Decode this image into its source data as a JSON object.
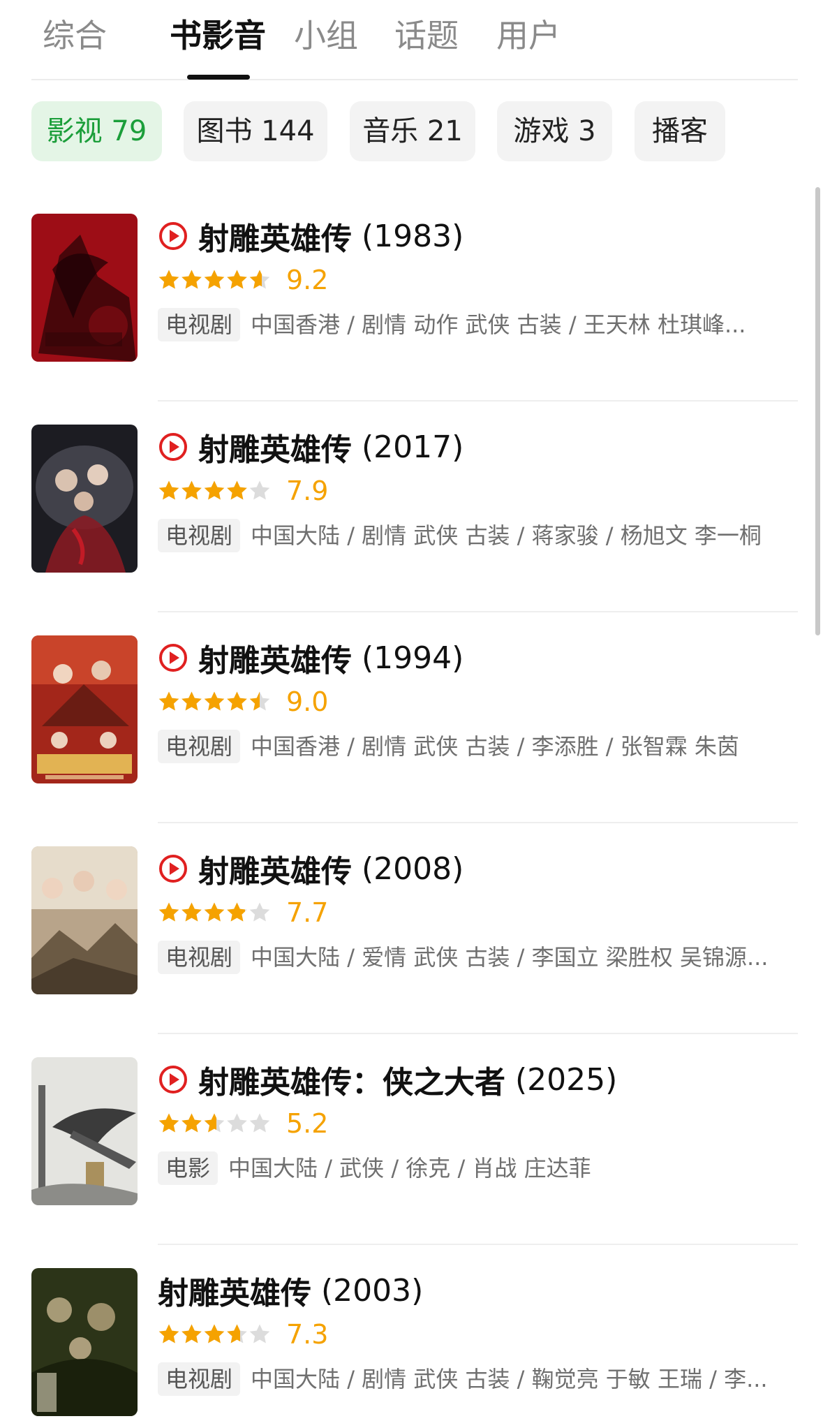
{
  "tabs": [
    {
      "label": "综合"
    },
    {
      "label": "书影音"
    },
    {
      "label": "小组"
    },
    {
      "label": "话题"
    },
    {
      "label": "用户"
    }
  ],
  "active_tab": "书影音",
  "chips": [
    {
      "label": "影视 79"
    },
    {
      "label": "图书 144"
    },
    {
      "label": "音乐 21"
    },
    {
      "label": "游戏 3"
    },
    {
      "label": "播客"
    }
  ],
  "active_chip": "影视 79",
  "accent_color": "#1b9e3a",
  "rating_color": "#f5a200",
  "play_icon_color": "#e02020",
  "results": [
    {
      "title": "射雕英雄传",
      "year": "(1983)",
      "playable": true,
      "rating": 9.2,
      "score_label": "9.2",
      "type": "电视剧",
      "meta": "中国香港 / 剧情 动作 武侠 古装 / 王天林 杜琪峰..."
    },
    {
      "title": "射雕英雄传",
      "year": "(2017)",
      "playable": true,
      "rating": 7.9,
      "score_label": "7.9",
      "type": "电视剧",
      "meta": "中国大陆 / 剧情 武侠 古装 / 蒋家骏 / 杨旭文 李一桐"
    },
    {
      "title": "射雕英雄传",
      "year": "(1994)",
      "playable": true,
      "rating": 9.0,
      "score_label": "9.0",
      "type": "电视剧",
      "meta": "中国香港 / 剧情 武侠 古装 / 李添胜 / 张智霖 朱茵"
    },
    {
      "title": "射雕英雄传",
      "year": "(2008)",
      "playable": true,
      "rating": 7.7,
      "score_label": "7.7",
      "type": "电视剧",
      "meta": "中国大陆 / 爱情 武侠 古装 / 李国立 梁胜权 吴锦源..."
    },
    {
      "title": "射雕英雄传：侠之大者",
      "year": "(2025)",
      "playable": true,
      "rating": 5.2,
      "score_label": "5.2",
      "type": "电影",
      "meta": "中国大陆 / 武侠 / 徐克 / 肖战 庄达菲"
    },
    {
      "title": "射雕英雄传",
      "year": "(2003)",
      "playable": false,
      "rating": 7.3,
      "score_label": "7.3",
      "type": "电视剧",
      "meta": "中国大陆 / 剧情 武侠 古装 / 鞠觉亮 于敏 王瑞 / 李..."
    }
  ]
}
